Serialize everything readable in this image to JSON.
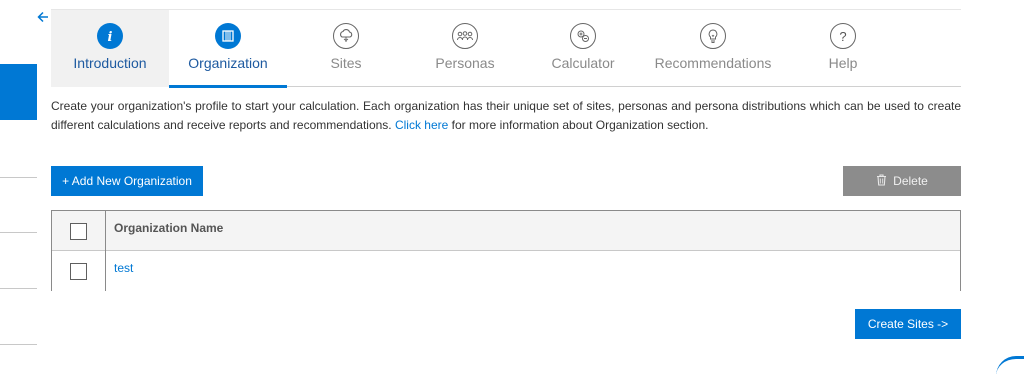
{
  "tabs": [
    {
      "label": "Introduction",
      "icon": "info-icon",
      "glyph": "i",
      "state": "visited"
    },
    {
      "label": "Organization",
      "icon": "building-icon",
      "glyph": "▥",
      "state": "active"
    },
    {
      "label": "Sites",
      "icon": "cloud-tree-icon",
      "glyph": "☁",
      "state": "inactive"
    },
    {
      "label": "Personas",
      "icon": "people-icon",
      "glyph": "ꙮ",
      "state": "inactive"
    },
    {
      "label": "Calculator",
      "icon": "calculator-icon",
      "glyph": "⊕",
      "state": "inactive"
    },
    {
      "label": "Recommendations",
      "icon": "lightbulb-icon",
      "glyph": "☊",
      "state": "inactive"
    },
    {
      "label": "Help",
      "icon": "question-icon",
      "glyph": "?",
      "state": "inactive"
    }
  ],
  "description": {
    "text_before": "Create your organization's profile to start your calculation. Each organization has their unique set of sites, personas and persona distributions which can be used to create different calculations and receive reports and recommendations. ",
    "link": "Click here",
    "text_after": " for more information about Organization section."
  },
  "toolbar": {
    "add_label": "+ Add New Organization",
    "delete_label": "Delete"
  },
  "table": {
    "header": "Organization Name",
    "rows": [
      "test"
    ]
  },
  "footer": {
    "create_label": "Create Sites ->"
  },
  "colors": {
    "accent": "#0078d4",
    "disabled": "#8c8c8c"
  }
}
